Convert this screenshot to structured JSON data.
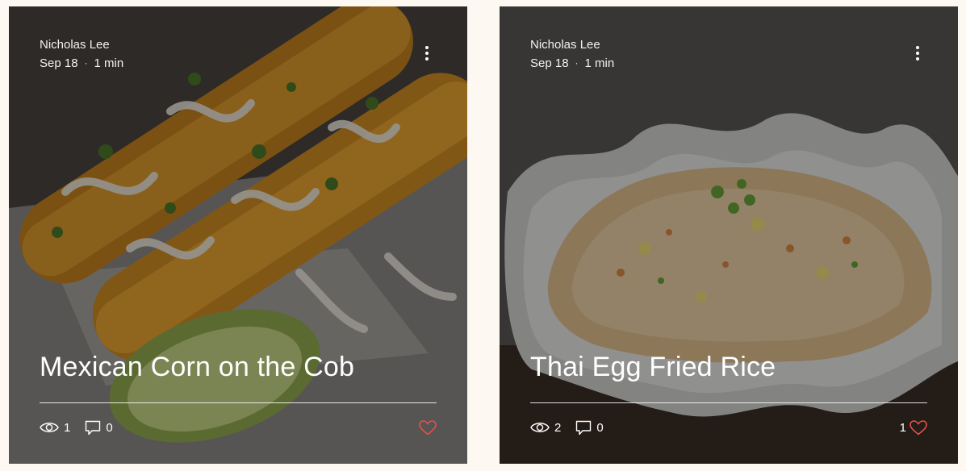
{
  "posts": [
    {
      "author": "Nicholas Lee",
      "date": "Sep 18",
      "separator": "·",
      "read_time": "1 min",
      "title": "Mexican Corn on the Cob",
      "views": "1",
      "comments": "0",
      "likes": "",
      "like_color": "#e8504b"
    },
    {
      "author": "Nicholas Lee",
      "date": "Sep 18",
      "separator": "·",
      "read_time": "1 min",
      "title": "Thai Egg Fried Rice",
      "views": "2",
      "comments": "0",
      "likes": "1",
      "like_color": "#e8504b"
    }
  ],
  "icons": {
    "more": "more-vertical-icon",
    "views": "eye-icon",
    "comments": "comment-icon",
    "like": "heart-icon"
  }
}
